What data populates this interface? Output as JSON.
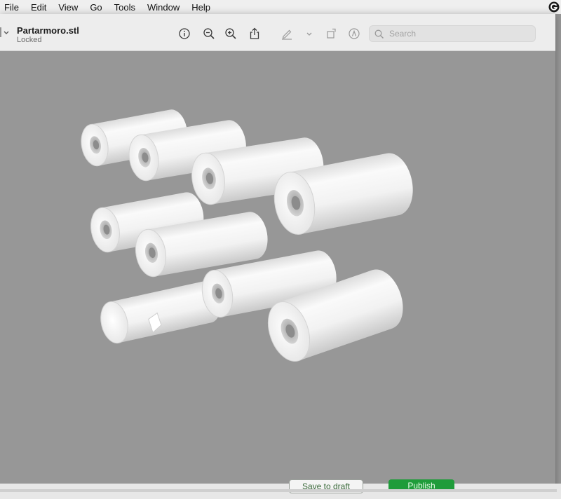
{
  "menubar": {
    "items": [
      "File",
      "Edit",
      "View",
      "Go",
      "Tools",
      "Window",
      "Help"
    ],
    "status_icon": "app-status-icon"
  },
  "document": {
    "title": "Partarmoro.stl",
    "subtitle": "Locked"
  },
  "toolbar": {
    "icons": [
      "info-icon",
      "zoom-out-icon",
      "zoom-in-icon",
      "share-icon",
      "markup-pen-icon",
      "chevron-down-icon",
      "rotate-icon",
      "annotate-icon"
    ],
    "search": {
      "placeholder": "Search",
      "value": ""
    }
  },
  "bottom": {
    "save_draft_label": "Save to draft",
    "publish_label": "Publish"
  },
  "colors": {
    "menubar_bg": "#efefef",
    "toolbar_bg": "#ededed",
    "viewport_bg": "#979797",
    "model": "#f4f4f4",
    "publish_green": "#1f9c3a"
  }
}
